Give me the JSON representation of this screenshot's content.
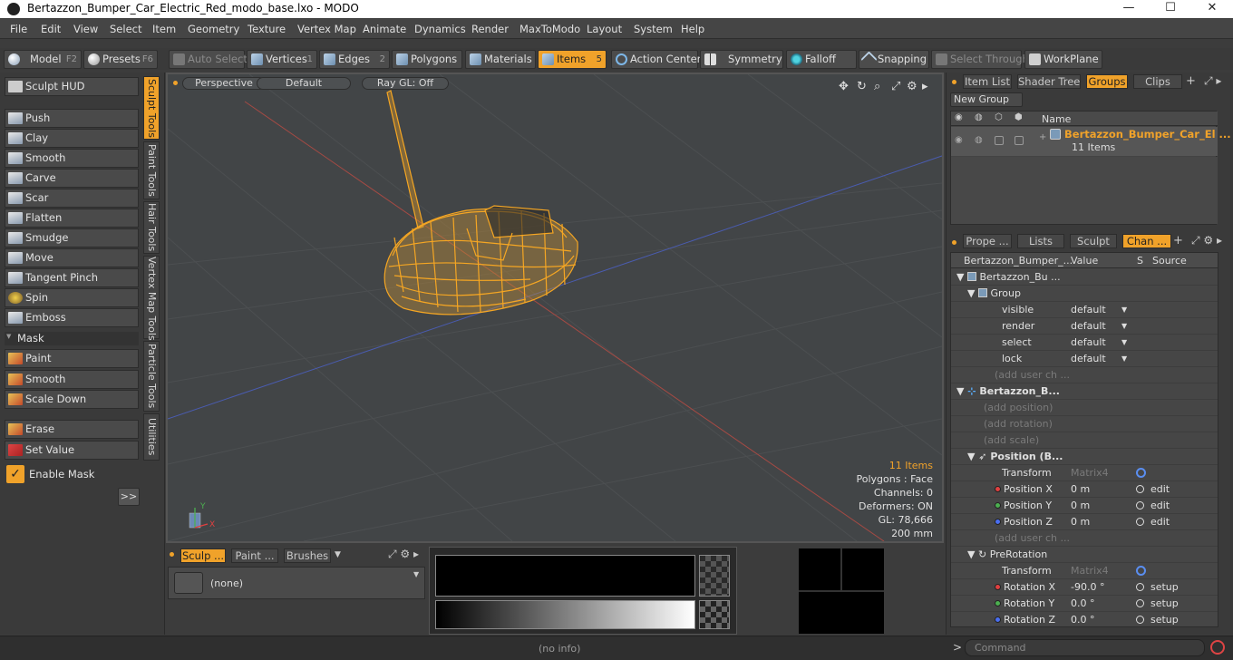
{
  "titlebar": {
    "title": "Bertazzon_Bumper_Car_Electric_Red_modo_base.lxo - MODO",
    "min": "—",
    "max": "☐",
    "close": "✕"
  },
  "menu": [
    "File",
    "Edit",
    "View",
    "Select",
    "Item",
    "Geometry",
    "Texture",
    "Vertex Map",
    "Animate",
    "Dynamics",
    "Render",
    "MaxToModo",
    "Layout",
    "System",
    "Help"
  ],
  "toolbar": {
    "model": "Model",
    "model_key": "F2",
    "presets": "Presets",
    "presets_key": "F6",
    "auto_select": "Auto Select",
    "vertices": "Vertices",
    "vertices_key": "1",
    "edges": "Edges",
    "edges_key": "2",
    "polygons": "Polygons",
    "materials": "Materials",
    "items": "Items",
    "items_key": "5",
    "action_center": "Action Center",
    "symmetry": "Symmetry",
    "falloff": "Falloff",
    "snapping": "Snapping",
    "select_through": "Select Through",
    "workplane": "WorkPlane"
  },
  "left": {
    "sculpt_hud": "Sculpt HUD",
    "tools": [
      "Push",
      "Clay",
      "Smooth",
      "Carve",
      "Scar",
      "Flatten",
      "Smudge",
      "Move",
      "Tangent Pinch",
      "Spin",
      "Emboss"
    ],
    "mask_label": "Mask",
    "mask_tools": [
      "Paint",
      "Smooth",
      "Scale Down"
    ],
    "extra_tools": [
      "Erase",
      "Set Value"
    ],
    "enable_mask": "Enable Mask",
    "more": ">>",
    "vtabs": [
      "Sculpt Tools",
      "Paint Tools",
      "Hair Tools",
      "Vertex Map Tools",
      "Particle Tools",
      "Utilities"
    ]
  },
  "viewport": {
    "perspective": "Perspective",
    "shading": "Default",
    "raygl": "Ray GL: Off",
    "axis_x": "X",
    "axis_y": "Y",
    "items_count": "11 Items",
    "polygons": "Polygons : Face",
    "channels": "Channels: 0",
    "deformers": "Deformers: ON",
    "gl": "GL: 78,666",
    "grid": "200 mm"
  },
  "bottom": {
    "tabs": [
      "Sculp ...",
      "Paint ...",
      "Brushes"
    ],
    "brush": "(none)"
  },
  "right": {
    "tabs_top": [
      "Item List",
      "Shader Tree",
      "Groups",
      "Clips"
    ],
    "new_group": "New Group",
    "name_header": "Name",
    "group_name": "Bertazzon_Bumper_Car_El ...",
    "group_count": "11 Items",
    "tabs_mid": [
      "Prope ...",
      "Lists",
      "Sculpt",
      "Chan ..."
    ],
    "col_name": "Bertazzon_Bumper_...",
    "col_value": "Value",
    "col_s": "S",
    "col_source": "Source",
    "rows": [
      {
        "name": "Bertazzon_Bu ...",
        "value": "",
        "src": ""
      },
      {
        "name": "Group",
        "value": "",
        "src": ""
      },
      {
        "name": "visible",
        "value": "default",
        "src": ""
      },
      {
        "name": "render",
        "value": "default",
        "src": ""
      },
      {
        "name": "select",
        "value": "default",
        "src": ""
      },
      {
        "name": "lock",
        "value": "default",
        "src": ""
      },
      {
        "name": "(add user ch ...",
        "value": "",
        "src": ""
      },
      {
        "name": "Bertazzon_B...",
        "value": "",
        "src": ""
      },
      {
        "name": "(add position)",
        "value": "",
        "src": ""
      },
      {
        "name": "(add rotation)",
        "value": "",
        "src": ""
      },
      {
        "name": "(add scale)",
        "value": "",
        "src": ""
      },
      {
        "name": "Position (B...",
        "value": "",
        "src": ""
      },
      {
        "name": "Transform",
        "value": "Matrix4",
        "src": ""
      },
      {
        "name": "Position X",
        "value": "0 m",
        "src": "edit"
      },
      {
        "name": "Position Y",
        "value": "0 m",
        "src": "edit"
      },
      {
        "name": "Position Z",
        "value": "0 m",
        "src": "edit"
      },
      {
        "name": "(add user ch ...",
        "value": "",
        "src": ""
      },
      {
        "name": "PreRotation",
        "value": "",
        "src": ""
      },
      {
        "name": "Transform",
        "value": "Matrix4",
        "src": ""
      },
      {
        "name": "Rotation X",
        "value": "-90.0 °",
        "src": "setup"
      },
      {
        "name": "Rotation Y",
        "value": "0.0 °",
        "src": "setup"
      },
      {
        "name": "Rotation Z",
        "value": "0.0 °",
        "src": "setup"
      }
    ]
  },
  "status": {
    "info": "(no info)",
    "command": "Command",
    "prompt": ">"
  },
  "colors": {
    "accent": "#f0a22a",
    "wire": "#f5a623",
    "bg": "#3a3a3a"
  }
}
